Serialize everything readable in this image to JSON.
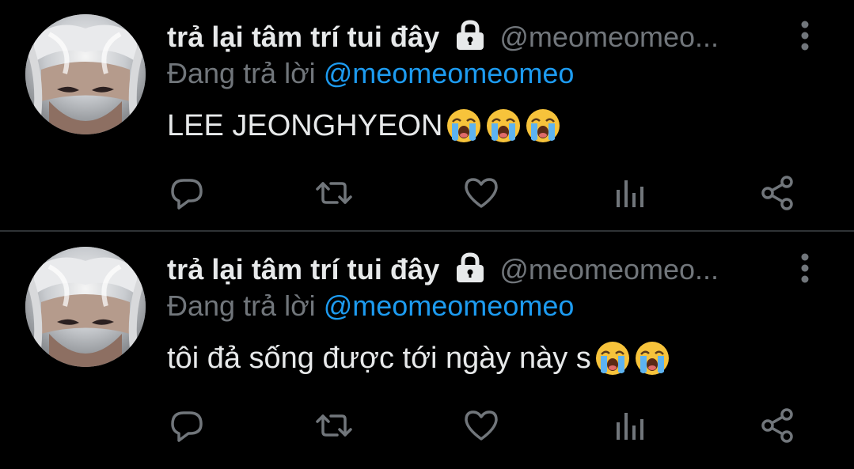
{
  "colors": {
    "background": "#000000",
    "primary_text": "#e7e9ea",
    "secondary_text": "#71767b",
    "accent": "#1d9bf0",
    "emoji_face": "#f7c33b"
  },
  "tweets": [
    {
      "display_name": "trả lại tâm trí tui đây",
      "handle": "@meomeomeo...",
      "reply_prefix": "Đang trả lời",
      "reply_to": "@meomeomeomeo",
      "text": "LEE JEONGHYEON",
      "emojis": [
        "loudly-crying-face",
        "loudly-crying-face",
        "loudly-crying-face"
      ]
    },
    {
      "display_name": "trả lại tâm trí tui đây",
      "handle": "@meomeomeo...",
      "reply_prefix": "Đang trả lời",
      "reply_to": "@meomeomeomeo",
      "text": "tôi đả sống được tới ngày này s",
      "emojis": [
        "loudly-crying-face",
        "loudly-crying-face"
      ]
    }
  ],
  "action_icons": [
    "reply-icon",
    "retweet-icon",
    "like-icon",
    "analytics-icon",
    "share-icon"
  ]
}
